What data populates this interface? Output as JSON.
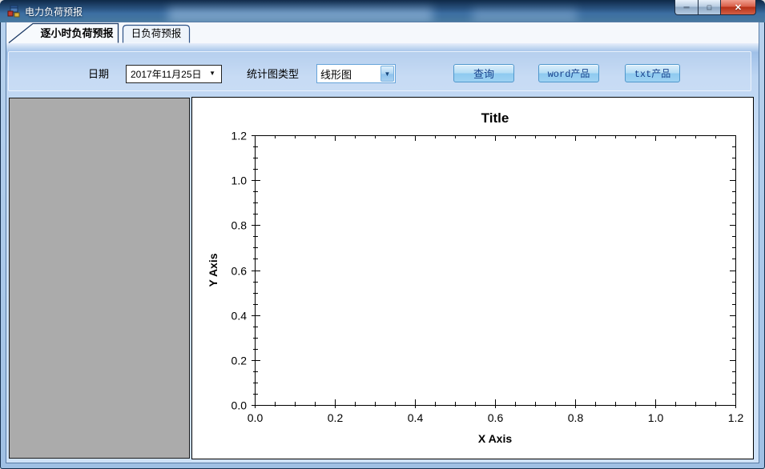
{
  "window": {
    "title": "电力负荷预报",
    "minimize_glyph": "─",
    "maximize_glyph": "□",
    "close_glyph": "✕"
  },
  "tabs": {
    "tab1": "逐小时负荷预报",
    "tab2": "日负荷预报"
  },
  "toolbar": {
    "date_label": "日期",
    "date_value": "2017年11月25日",
    "date_arrow": "▼",
    "chart_type_label": "统计图类型",
    "chart_type_value": "线形图",
    "chart_type_arrow": "▼",
    "query_button": "查询",
    "word_button": "word产品",
    "txt_button": "txt产品"
  },
  "colors": {
    "accent_border": "#4f97cc",
    "button_text": "#16418c",
    "page_bg": "#cfe2f8",
    "panel_gray": "#ababab",
    "chart_fg": "#000000"
  },
  "chart_data": {
    "type": "line",
    "title": "Title",
    "xlabel": "X Axis",
    "ylabel": "Y Axis",
    "xlim": [
      0.0,
      1.2
    ],
    "ylim": [
      0.0,
      1.2
    ],
    "x_ticks": [
      0.0,
      0.2,
      0.4,
      0.6,
      0.8,
      1.0,
      1.2
    ],
    "y_ticks": [
      0.0,
      0.2,
      0.4,
      0.6,
      0.8,
      1.0,
      1.2
    ],
    "x_tick_labels": [
      "0.0",
      "0.2",
      "0.4",
      "0.6",
      "0.8",
      "1.0",
      "1.2"
    ],
    "y_tick_labels": [
      "0.0",
      "0.2",
      "0.4",
      "0.6",
      "0.8",
      "1.0",
      "1.2"
    ],
    "x_minor_step": 0.05,
    "y_minor_step": 0.05,
    "grid": false,
    "legend": false,
    "series": []
  }
}
